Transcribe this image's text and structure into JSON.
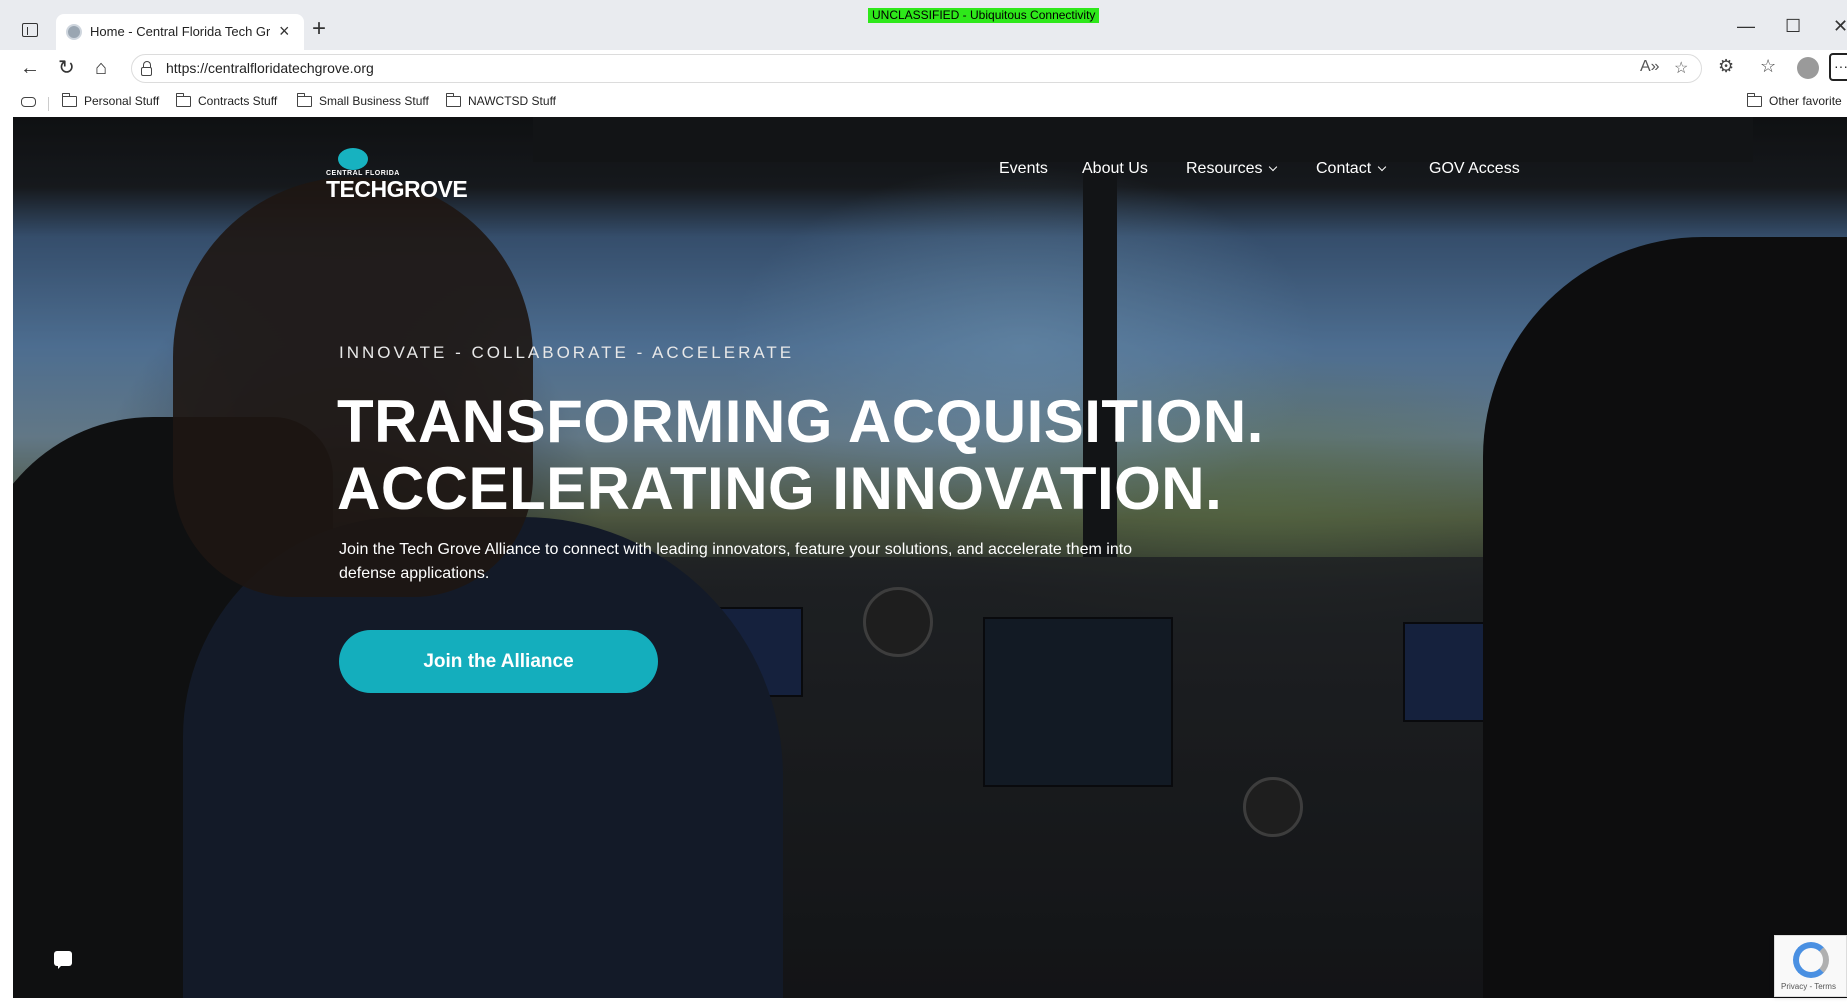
{
  "browser": {
    "banner": "UNCLASSIFIED - Ubiquitous Connectivity",
    "tab_title": "Home - Central Florida Tech Grov",
    "url": "https://centralfloridatechgrove.org",
    "window_controls": {
      "minimize": "—",
      "maximize": "☐",
      "close": "✕"
    },
    "favorites": [
      "Personal Stuff",
      "Contracts Stuff",
      "Small Business Stuff",
      "NAWCTSD Stuff"
    ],
    "other_favorites": "Other favorite"
  },
  "site": {
    "logo": {
      "small": "CENTRAL FLORIDA",
      "main": "TECHGROVE"
    },
    "nav": [
      {
        "label": "Events"
      },
      {
        "label": "About Us"
      },
      {
        "label": "Resources"
      },
      {
        "label": "Contact"
      },
      {
        "label": "GOV Access"
      }
    ],
    "hero": {
      "eyebrow": "INNOVATE - COLLABORATE - ACCELERATE",
      "headline_1": "TRANSFORMING ACQUISITION.",
      "headline_2": "ACCELERATING INNOVATION.",
      "lede": "Join the Tech Grove Alliance to connect with leading innovators, feature your solutions, and accelerate them into defense applications.",
      "cta": "Join the Alliance"
    },
    "recaptcha_text": "Privacy - Terms"
  },
  "colors": {
    "accent": "#14aebd",
    "banner": "#2ee81a"
  }
}
